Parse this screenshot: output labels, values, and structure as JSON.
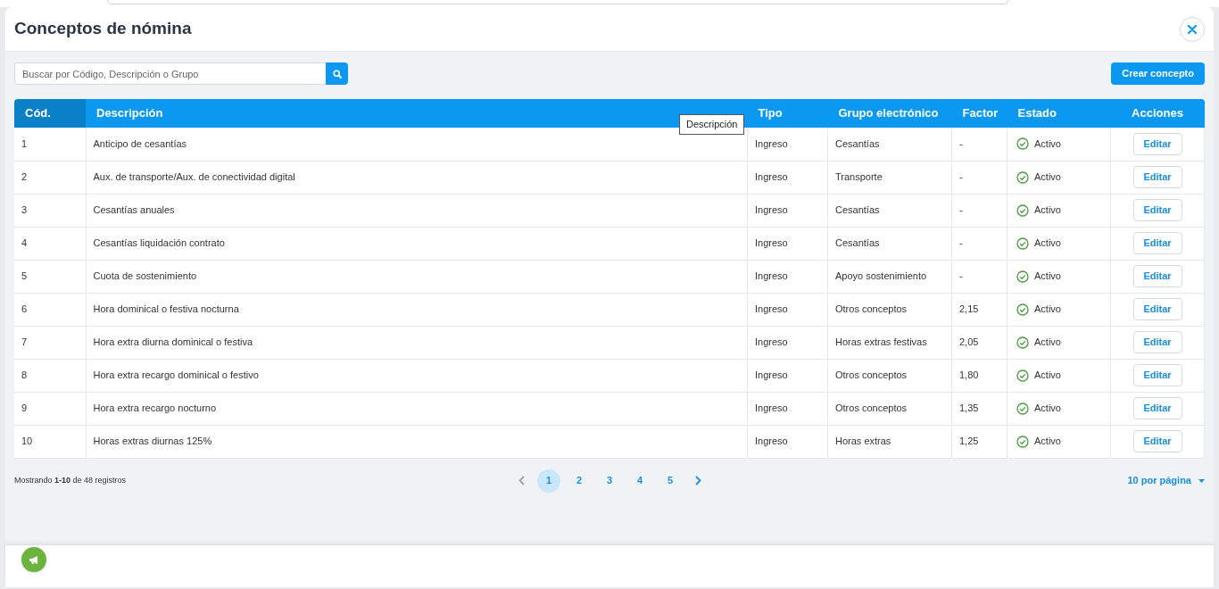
{
  "dialog": {
    "title": "Conceptos de nómina"
  },
  "search": {
    "placeholder": "Buscar por Código, Descripción o Grupo"
  },
  "create_button": "Crear concepto",
  "table": {
    "columns": [
      {
        "label": "Cód.",
        "sorted": true
      },
      {
        "label": "Descripción",
        "sorted": false
      },
      {
        "label": "Tipo",
        "sorted": false
      },
      {
        "label": "Grupo electrónico",
        "sorted": false
      },
      {
        "label": "Factor",
        "sorted": false
      },
      {
        "label": "Estado",
        "sorted": false
      },
      {
        "label": "Acciones",
        "sorted": false
      }
    ],
    "tooltip": "Descripción",
    "rows": [
      {
        "code": "1",
        "description": "Anticipo de cesantías",
        "type": "Ingreso",
        "group": "Cesantías",
        "factor": "-",
        "status": "Activo",
        "action": "Editar"
      },
      {
        "code": "2",
        "description": "Aux. de transporte/Aux. de conectividad digital",
        "type": "Ingreso",
        "group": "Transporte",
        "factor": "-",
        "status": "Activo",
        "action": "Editar"
      },
      {
        "code": "3",
        "description": "Cesantías anuales",
        "type": "Ingreso",
        "group": "Cesantías",
        "factor": "-",
        "status": "Activo",
        "action": "Editar"
      },
      {
        "code": "4",
        "description": "Cesantías liquidación contrato",
        "type": "Ingreso",
        "group": "Cesantías",
        "factor": "-",
        "status": "Activo",
        "action": "Editar"
      },
      {
        "code": "5",
        "description": "Cuota de sostenimiento",
        "type": "Ingreso",
        "group": "Apoyo sostenimiento",
        "factor": "-",
        "status": "Activo",
        "action": "Editar"
      },
      {
        "code": "6",
        "description": "Hora dominical o festiva nocturna",
        "type": "Ingreso",
        "group": "Otros conceptos",
        "factor": "2,15",
        "status": "Activo",
        "action": "Editar"
      },
      {
        "code": "7",
        "description": "Hora extra diurna dominical o festiva",
        "type": "Ingreso",
        "group": "Horas extras festivas",
        "factor": "2,05",
        "status": "Activo",
        "action": "Editar"
      },
      {
        "code": "8",
        "description": "Hora extra recargo dominical o festivo",
        "type": "Ingreso",
        "group": "Otros conceptos",
        "factor": "1,80",
        "status": "Activo",
        "action": "Editar"
      },
      {
        "code": "9",
        "description": "Hora extra recargo nocturno",
        "type": "Ingreso",
        "group": "Otros conceptos",
        "factor": "1,35",
        "status": "Activo",
        "action": "Editar"
      },
      {
        "code": "10",
        "description": "Horas extras diurnas 125%",
        "type": "Ingreso",
        "group": "Horas extras",
        "factor": "1,25",
        "status": "Activo",
        "action": "Editar"
      }
    ]
  },
  "footer": {
    "summary": "Mostrando **1-10** de 48 registros",
    "prev_disabled": true,
    "pages": [
      {
        "label": "1",
        "selected": true
      },
      {
        "label": "2",
        "selected": false
      },
      {
        "label": "3",
        "selected": false
      },
      {
        "label": "4",
        "selected": false
      },
      {
        "label": "5",
        "selected": false
      }
    ],
    "per_page": "10 por página"
  }
}
